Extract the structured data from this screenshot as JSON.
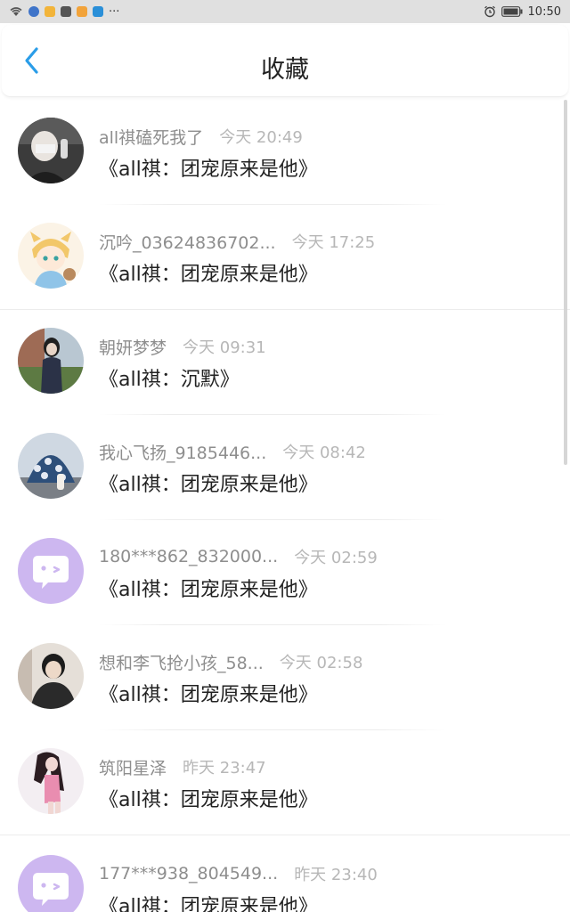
{
  "status_bar": {
    "time": "10:50",
    "more": "···"
  },
  "header": {
    "title": "收藏"
  },
  "favorites": [
    {
      "username": "all祺磕死我了",
      "time": "今天 20:49",
      "content": "《all祺：团宠原来是他》",
      "avatar": "photo"
    },
    {
      "username": "沉吟_03624836702...",
      "time": "今天 17:25",
      "content": "《all祺：团宠原来是他》",
      "avatar": "illustration"
    },
    {
      "username": "朝妍梦梦",
      "time": "今天 09:31",
      "content": "《all祺：沉默》",
      "avatar": "photo"
    },
    {
      "username": "我心飞扬_9185446...",
      "time": "今天 08:42",
      "content": "《all祺：团宠原来是他》",
      "avatar": "photo"
    },
    {
      "username": "180***862_832000...",
      "time": "今天 02:59",
      "content": "《all祺：团宠原来是他》",
      "avatar": "default"
    },
    {
      "username": "想和李飞抢小孩_58...",
      "time": "今天 02:58",
      "content": "《all祺：团宠原来是他》",
      "avatar": "photo"
    },
    {
      "username": "筑阳星泽",
      "time": "昨天 23:47",
      "content": "《all祺：团宠原来是他》",
      "avatar": "photo"
    },
    {
      "username": "177***938_804549...",
      "time": "昨天 23:40",
      "content": "《all祺：团宠原来是他》",
      "avatar": "default"
    }
  ],
  "colors": {
    "accent": "#2a9de8",
    "default_avatar": "#cdb7f0"
  },
  "icons": {
    "back": "chevron-left-icon",
    "default_avatar": "chat-bubble-face-icon"
  }
}
